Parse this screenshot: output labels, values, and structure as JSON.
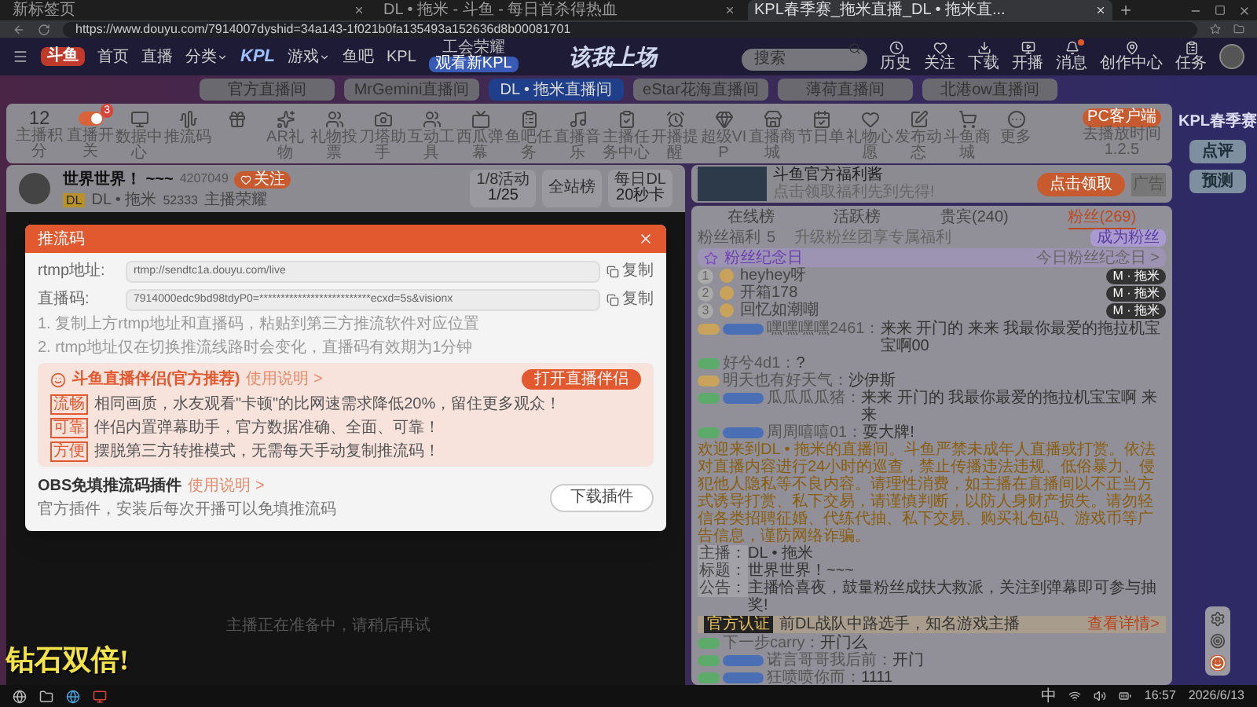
{
  "browser": {
    "tabs": [
      {
        "title": "新标签页",
        "selected": false
      },
      {
        "title": "DL • 拖米 - 斗鱼 - 每日首杀得热血",
        "selected": false
      },
      {
        "title": "KPL春季赛_拖米直播_DL • 拖米直...",
        "selected": true
      }
    ],
    "url": "https://www.douyu.com/7914007dyshid=34a143-1f021b0fa135493a152636d8b00081701"
  },
  "nav": {
    "logo": "斗鱼",
    "items": [
      {
        "label": "首页",
        "kind": "link"
      },
      {
        "label": "直播",
        "kind": "link"
      },
      {
        "label": "分类",
        "kind": "dropdown"
      },
      {
        "label": "KPL",
        "kind": "logo"
      },
      {
        "label": "游戏",
        "kind": "dropdown"
      },
      {
        "label": "鱼吧",
        "kind": "link"
      },
      {
        "label": "KPL",
        "kind": "link"
      }
    ],
    "promo": {
      "title": "工会荣耀",
      "badge": "观看新KPL"
    },
    "banner": "该我上场",
    "search": {
      "placeholder": "搜索"
    },
    "actions": [
      {
        "label": "历史",
        "notify": false
      },
      {
        "label": "关注",
        "notify": false
      },
      {
        "label": "下载",
        "notify": false
      },
      {
        "label": "开播",
        "notify": false
      },
      {
        "label": "消息",
        "notify": true
      },
      {
        "label": "创作中心",
        "notify": false
      },
      {
        "label": "任务",
        "notify": false
      }
    ]
  },
  "room_tabs": [
    {
      "label": "官方直播间",
      "selected": false
    },
    {
      "label": "MrGemini直播间",
      "selected": false
    },
    {
      "label": "DL • 拖米直播间",
      "selected": true
    },
    {
      "label": "eStar花海直播间",
      "selected": false
    },
    {
      "label": "薄荷直播间",
      "selected": false
    },
    {
      "label": "北港ow直播间",
      "selected": false
    }
  ],
  "toolbar": {
    "items": [
      {
        "kind": "score",
        "value": "12",
        "label": "主播积分"
      },
      {
        "kind": "toggle",
        "label": "直播开关",
        "on": true,
        "badge": "3"
      },
      {
        "kind": "tool",
        "label": "数据中心"
      },
      {
        "kind": "tool",
        "label": "推流码"
      },
      {
        "kind": "tool"
      },
      {
        "kind": "tool",
        "label": "AR礼物"
      },
      {
        "kind": "tool",
        "label": "礼物投票"
      },
      {
        "kind": "tool",
        "label": "刀塔助手"
      },
      {
        "kind": "tool",
        "label": "互动工具"
      },
      {
        "kind": "tool",
        "label": "西瓜弹幕"
      },
      {
        "kind": "tool",
        "label": "鱼吧任务"
      },
      {
        "kind": "tool",
        "label": "直播音乐"
      },
      {
        "kind": "tool",
        "label": "主播任务中心"
      },
      {
        "kind": "tool",
        "label": "开播提醒"
      },
      {
        "kind": "tool",
        "label": "超级VIP"
      },
      {
        "kind": "tool",
        "label": "直播商城"
      },
      {
        "kind": "tool",
        "label": "节日单"
      },
      {
        "kind": "tool",
        "label": "礼物心愿"
      },
      {
        "kind": "tool",
        "label": "发布动态"
      },
      {
        "kind": "tool",
        "label": "斗鱼商城"
      },
      {
        "kind": "tool",
        "label": "更多"
      }
    ],
    "client_button": "PC客户端",
    "client_note": "去播放时间1.2.5"
  },
  "streamer": {
    "name": "世界世界！ ~~~",
    "room_id": "4207049",
    "follow": "关注",
    "level": "DL",
    "team": "DL • 拖米",
    "fans": "52333",
    "tag": "主播荣耀",
    "stats": [
      {
        "title": "1/8活动",
        "value": "1/25"
      },
      {
        "title": "全站榜"
      },
      {
        "title": "每日DL",
        "value": "20秒卡"
      }
    ]
  },
  "video_notice": "主播正在准备中，请稍后再试",
  "dialog": {
    "title": "推流码",
    "fields": [
      {
        "label": "rtmp地址:",
        "value": "rtmp://sendtc1a.douyu.com/live",
        "copy": "复制"
      },
      {
        "label": "直播码:",
        "value": "7914000edc9bd98tdyP0=**************************ecxd=5s&visionx",
        "copy": "复制"
      }
    ],
    "notes": [
      "1. 复制上方rtmp地址和直播码，粘贴到第三方推流软件对应位置",
      "2. rtmp地址仅在切换推流线路时会变化，直播码有效期为1分钟"
    ],
    "partner": {
      "title": "斗鱼直播伴侣(官方推荐)",
      "help": "使用说明 >",
      "button": "打开直播伴侣",
      "points": [
        {
          "tag": "流畅",
          "text": "相同画质，水友观看\"卡顿\"的比网速需求降低20%，留住更多观众！"
        },
        {
          "tag": "可靠",
          "text": "伴侣内置弹幕助手，官方数据准确、全面、可靠！"
        },
        {
          "tag": "方便",
          "text": "摆脱第三方转推模式，无需每天手动复制推流码！"
        }
      ]
    },
    "plugin": {
      "title": "OBS免填推流码插件",
      "help": "使用说明 >",
      "text": "官方插件，安装后每次开播可以免填推流码",
      "button": "下载插件"
    }
  },
  "ad": {
    "title": "斗鱼官方福利酱",
    "subtitle": "点击领取福利先到先得!",
    "button": "点击领取",
    "tag": "广告"
  },
  "chat": {
    "tabs": [
      {
        "label": "在线榜",
        "selected": false
      },
      {
        "label": "活跃榜",
        "selected": false
      },
      {
        "label": "贵宾(240)",
        "selected": false
      },
      {
        "label": "粉丝(269)",
        "selected": true
      }
    ],
    "fan_row": {
      "label": "粉丝福利",
      "count": "5",
      "hint": "升级粉丝团享专属福利",
      "button": "成为粉丝"
    },
    "anniversary": {
      "title": "粉丝纪念日",
      "link": "今日粉丝纪念日 >"
    },
    "fans": [
      {
        "rank": "1",
        "name": "heyhey呀",
        "badge": "M · 拖米"
      },
      {
        "rank": "2",
        "name": "开箱178",
        "badge": "M · 拖米"
      },
      {
        "rank": "3",
        "name": "回忆如潮嘲",
        "badge": "M · 拖米"
      }
    ],
    "messages": [
      {
        "kind": "chat",
        "color": "#c9a35c",
        "fan_badge": true,
        "user": "嘿嘿嘿嘿2461：",
        "text": "来来 开门的 来来 我最你最爱的拖拉机宝宝啊00"
      },
      {
        "kind": "chat",
        "color": "#5cab6a",
        "fan_badge": false,
        "user": "好兮4d1：",
        "text": "?"
      },
      {
        "kind": "chat",
        "color": "#c9a35c",
        "fan_badge": false,
        "user": "明天也有好天气：",
        "text": "沙伊斯"
      },
      {
        "kind": "chat",
        "color": "#5cab6a",
        "fan_badge": true,
        "user": "瓜瓜瓜瓜猪：",
        "text": "来来 开门的 我最你最爱的拖拉机宝宝啊 来来"
      },
      {
        "kind": "chat",
        "color": "#5cab6a",
        "fan_badge": true,
        "user": "周周嘻嘻01：",
        "text": "耍大牌!"
      },
      {
        "kind": "notice",
        "text": "欢迎来到DL • 拖米的直播间。斗鱼严禁未成年人直播或打赏。依法对直播内容进行24小时的巡查，禁止传播违法违规、低俗暴力、侵犯他人隐私等不良内容。请理性消费，如主播在直播间以不正当方式诱导打赏、私下交易，请谨慎判断，以防人身财产损失。请勿轻信各类招聘征婚、代练代抽、私下交易、购买礼包码、游戏币等广告信息，谨防网络诈骗。"
      },
      {
        "kind": "info",
        "label": "主播：",
        "text": "DL • 拖米"
      },
      {
        "kind": "info",
        "label": "标题：",
        "text": "世界世界！~~~"
      },
      {
        "kind": "info",
        "label": "公告：",
        "text": "主播恰喜夜，鼓量粉丝成扶大救派，关注到弹幕即可参与抽奖!"
      },
      {
        "kind": "official",
        "tag": "官方认证",
        "text": "前DL战队中路选手，知名游戏主播",
        "link": "查看详情>"
      },
      {
        "kind": "chat",
        "color": "#5cab6a",
        "fan_badge": false,
        "user": "下一步carry：",
        "text": "开门么"
      },
      {
        "kind": "chat",
        "color": "#5cab6a",
        "fan_badge": true,
        "user": "诺言哥哥我后前：",
        "text": "开门"
      },
      {
        "kind": "chat",
        "color": "#5cab6a",
        "fan_badge": true,
        "user": "狂喷喷你而：",
        "text": "1111"
      }
    ]
  },
  "kpl": {
    "title": "KPL春季赛",
    "buttons": [
      "点评",
      "预测"
    ]
  },
  "overlay_text": "钻石双倍!",
  "taskbar": {
    "ime": "中",
    "time": "16:57",
    "date": "2026/6/13"
  }
}
